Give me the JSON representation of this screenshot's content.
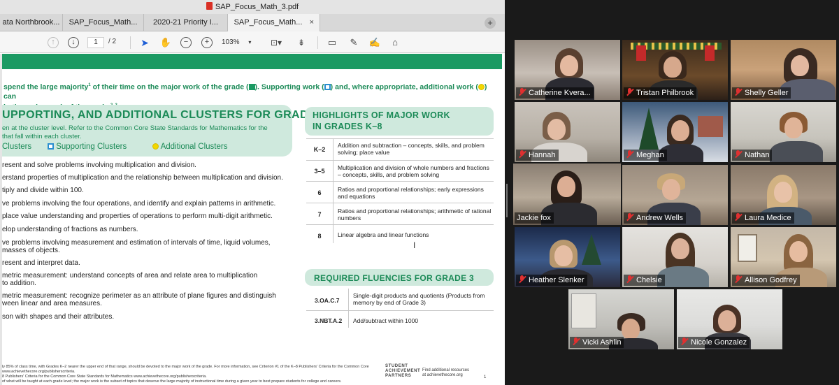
{
  "viewer": {
    "title": "SAP_Focus_Math_3.pdf",
    "tabs": [
      {
        "label": "ata Northbrook..."
      },
      {
        "label": "SAP_Focus_Math..."
      },
      {
        "label": "2020-21 Priority I..."
      },
      {
        "label": "SAP_Focus_Math..."
      }
    ],
    "tab_close": "×",
    "tab_add": "+",
    "page_current": "1",
    "page_total": "/ 2",
    "zoom": "103%"
  },
  "document": {
    "intro_line1_a": "spend the large majority",
    "intro_sup1": "1",
    "intro_line1_b": " of their time on the major work of the grade (",
    "intro_line1_c": "). Supporting work (",
    "intro_line1_d": ") and, where appropriate, additional work (",
    "intro_line1_e": ") can",
    "intro_line2": "in the major work of the grade.",
    "intro_sup2": "2, 3",
    "cluster_heading": "UPPORTING, AND ADDITIONAL CLUSTERS FOR GRADE 3",
    "cluster_sub1": "en at the cluster level. Refer to the Common Core State Standards for Mathematics for the",
    "cluster_sub2": "that fall within each cluster.",
    "legend_major": "Clusters",
    "legend_supporting": "Supporting Clusters",
    "legend_additional": "Additional Clusters",
    "clusters": [
      "resent and solve problems involving multiplication and division.",
      "erstand properties of multiplication and the relationship between multiplication and division.",
      "tiply and divide within 100.",
      "ve problems involving the four operations, and identify and explain patterns in arithmetic.",
      " place value understanding and properties of operations to perform multi-digit arithmetic.",
      "elop understanding of fractions as numbers.",
      "ve problems involving measurement and estimation of intervals of time, liquid volumes,",
      "masses of objects.",
      "resent and interpret data.",
      "metric measurement: understand concepts of area and relate area to multiplication",
      "to addition.",
      "metric measurement: recognize perimeter as an attribute of plane figures and distinguish",
      "ween linear and area measures.",
      "son with shapes and their attributes."
    ],
    "highlights_title1": "HIGHLIGHTS OF MAJOR WORK",
    "highlights_title2": "IN GRADES K–8",
    "highlights": [
      {
        "grade": "K–2",
        "text": "Addition and subtraction – concepts, skills, and problem solving; place value"
      },
      {
        "grade": "3–5",
        "text": "Multiplication and division of whole numbers and fractions – concepts, skills, and problem solving"
      },
      {
        "grade": "6",
        "text": "Ratios and proportional relationships; early expressions and equations"
      },
      {
        "grade": "7",
        "text": "Ratios and proportional relationships; arithmetic of rational numbers"
      },
      {
        "grade": "8",
        "text": "Linear algebra and linear functions"
      }
    ],
    "fluencies_title": "REQUIRED FLUENCIES FOR GRADE 3",
    "fluencies": [
      {
        "code": "3.OA.C.7",
        "text": "Single-digit products and quotients (Products from memory by end of Grade 3)"
      },
      {
        "code": "3.NBT.A.2",
        "text": "Add/subtract within 1000"
      }
    ],
    "footnote1": "ly 85% of class time, with Grades K–2 nearer the upper end of that range, should be devoted to the major work of the grade. For more information, see Criterion #1 of the K–8 Publishers' Criteria for the Common Core",
    "footnote2": "www.achievethecore.org/publisherscriteria.",
    "footnote3": "8 Publishers' Criteria for the Common Core State Standards for Mathematics www.achievethecore.org/publisherscriteria.",
    "footnote4": "of what will be taught at each grade level; the major work is the subset of topics that deserve the large majority of instructional time during a given year to best prepare students for college and careers.",
    "logo_line1": "STUDENT",
    "logo_line2": "ACHIEVEMENT",
    "logo_line3": "PARTNERS",
    "find_line1": "Find additional resources",
    "find_line2": "at achievethecore.org",
    "page_number": "1"
  },
  "participants": [
    {
      "name": "Catherine Kvera..."
    },
    {
      "name": "Tristan Philbrook"
    },
    {
      "name": "Shelly Geller"
    },
    {
      "name": "Hannah"
    },
    {
      "name": "Meghan"
    },
    {
      "name": "Nathan"
    },
    {
      "name": "Jackie fox"
    },
    {
      "name": "Andrew Wells"
    },
    {
      "name": "Laura Medice"
    },
    {
      "name": "Heather Slenker"
    },
    {
      "name": "Chelsie"
    },
    {
      "name": "Allison Godfrey"
    },
    {
      "name": "Vicki Ashlin"
    },
    {
      "name": "Nicole Gonzalez"
    }
  ],
  "colors": {
    "accent_green": "#1b9a63",
    "panel_green": "#cfe9dd",
    "active_speaker": "#e8e800",
    "muted_mic": "#e03030"
  },
  "icons": [
    "pdf-icon",
    "prev-page-icon",
    "next-page-icon",
    "pointer-icon",
    "hand-icon",
    "zoom-out-icon",
    "zoom-in-icon",
    "fit-icon",
    "scroll-icon",
    "comment-icon",
    "highlight-icon",
    "sign-icon",
    "tag-icon",
    "mic-muted-icon"
  ]
}
